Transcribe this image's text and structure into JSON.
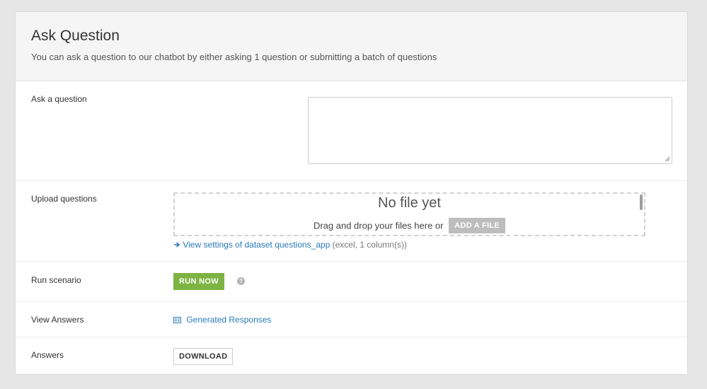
{
  "header": {
    "title": "Ask Question",
    "subtitle": "You can ask a question to our chatbot by either asking 1 question or submitting a batch of questions"
  },
  "ask": {
    "label": "Ask a question",
    "value": ""
  },
  "upload": {
    "label": "Upload questions",
    "dropzone_title": "No file yet",
    "drag_text": "Drag and drop your files here or",
    "add_file_label": "ADD A FILE",
    "dataset_link_text": "View settings of dataset questions_app",
    "dataset_meta": "(excel, 1 column(s))"
  },
  "run": {
    "label": "Run scenario",
    "button_label": "RUN NOW",
    "help_glyph": "?"
  },
  "view": {
    "label": "View Answers",
    "link_text": "Generated Responses"
  },
  "answers": {
    "label": "Answers",
    "button_label": "DOWNLOAD"
  },
  "colors": {
    "accent_link": "#2a7ab8",
    "run_button": "#7cb342",
    "add_file_button": "#bdbdbd"
  },
  "icons": {
    "link_arrow": "arrow-right-icon",
    "dataset": "dataset-icon",
    "help": "question-circle-icon",
    "resize": "resize-grip-icon"
  }
}
